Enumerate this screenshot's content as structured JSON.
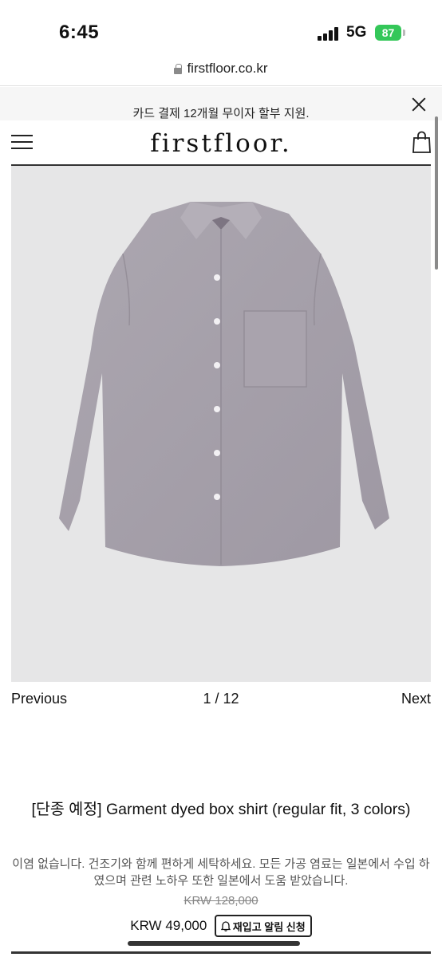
{
  "status_bar": {
    "time": "6:45",
    "network": "5G",
    "battery": "87"
  },
  "browser": {
    "url": "firstfloor.co.kr"
  },
  "promo": {
    "text": "카드 결제 12개월 무이자 할부 지원."
  },
  "header": {
    "logo": "firstfloor."
  },
  "gallery": {
    "prev_label": "Previous",
    "counter": "1 / 12",
    "next_label": "Next"
  },
  "product": {
    "title": "[단종 예정] Garment dyed box shirt (regular fit, 3 colors)",
    "description": "이염 없습니다. 건조기와 함께 편하게 세탁하세요. 모든 가공 염료는 일본에서 수입 하였으며 관련 노하우 또한 일본에서 도움 받았습니다.",
    "original_price": "KRW 128,000",
    "price": "KRW 49,000",
    "restock_label": "재입고 알림 신청",
    "image_color": "#a5a0a9"
  }
}
